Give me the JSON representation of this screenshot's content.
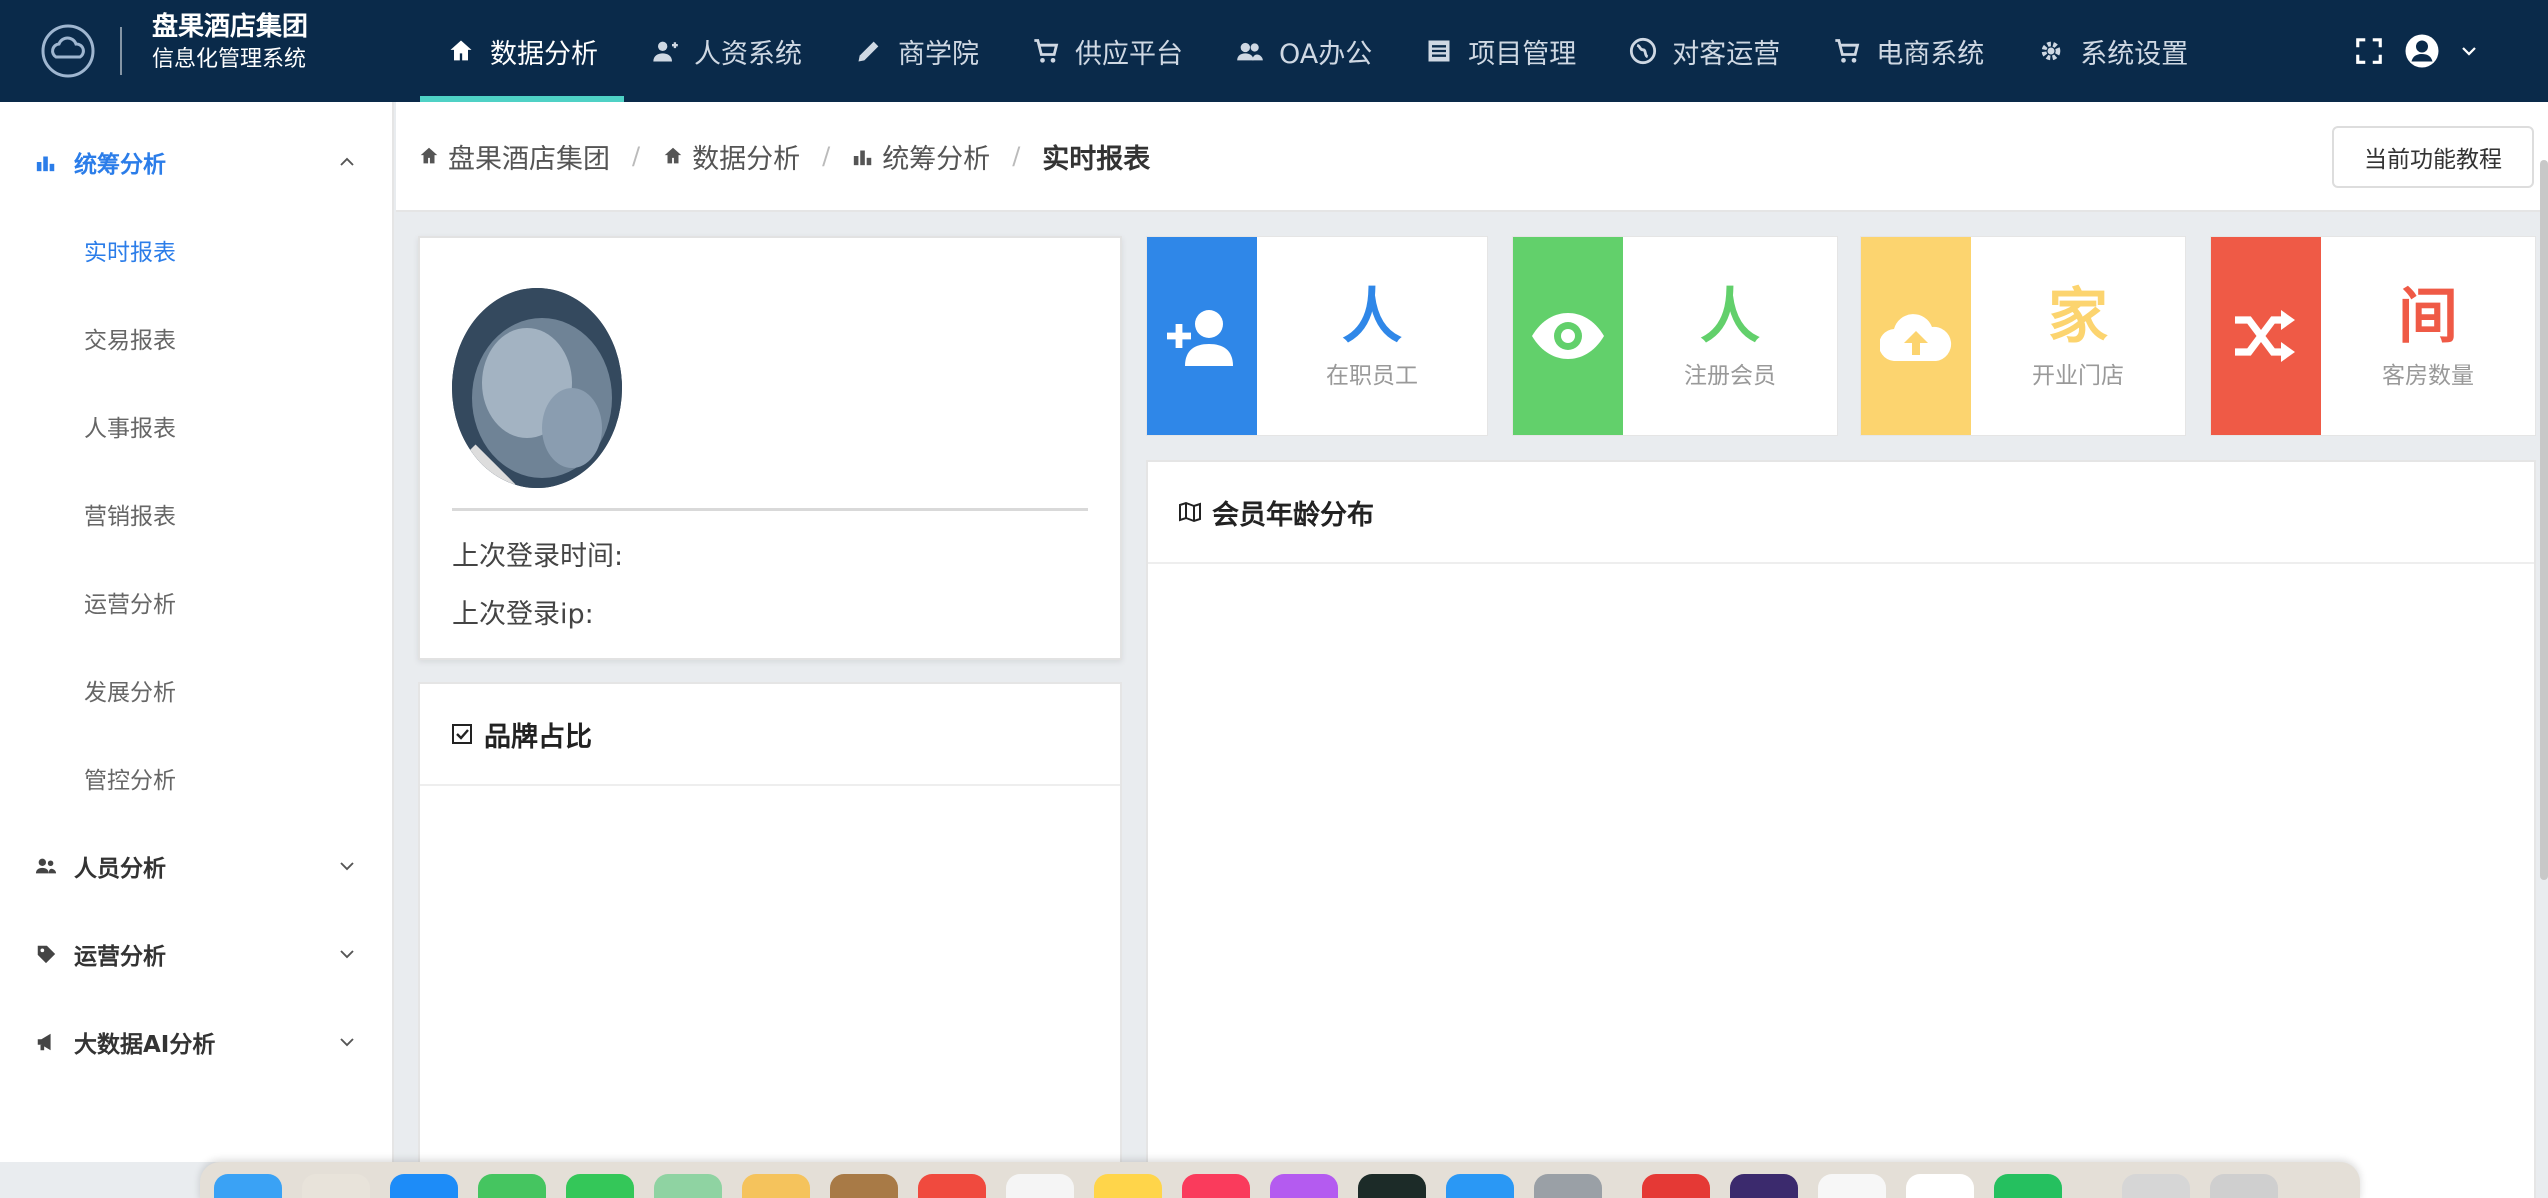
{
  "header": {
    "company": "盘果酒店集团",
    "system": "信息化管理系统",
    "nav": [
      {
        "label": "数据分析",
        "icon": "home-icon",
        "active": true
      },
      {
        "label": "人资系统",
        "icon": "user-add-icon"
      },
      {
        "label": "商学院",
        "icon": "pencil-icon"
      },
      {
        "label": "供应平台",
        "icon": "cart-icon"
      },
      {
        "label": "OA办公",
        "icon": "users-icon"
      },
      {
        "label": "项目管理",
        "icon": "list-icon"
      },
      {
        "label": "对客运营",
        "icon": "globe-icon"
      },
      {
        "label": "电商系统",
        "icon": "cart-icon"
      },
      {
        "label": "系统设置",
        "icon": "gear-icon"
      }
    ]
  },
  "sidebar": {
    "groups": [
      {
        "label": "统筹分析",
        "icon": "bar-chart-icon",
        "open": true,
        "items": [
          "实时报表",
          "交易报表",
          "人事报表",
          "营销报表",
          "运营分析",
          "发展分析",
          "管控分析"
        ],
        "active_item": "实时报表"
      },
      {
        "label": "人员分析",
        "icon": "people-icon",
        "open": false
      },
      {
        "label": "运营分析",
        "icon": "tag-icon",
        "open": false
      },
      {
        "label": "大数据AI分析",
        "icon": "megaphone-icon",
        "open": false
      }
    ]
  },
  "breadcrumb": {
    "items": [
      "盘果酒店集团",
      "数据分析",
      "统筹分析"
    ],
    "current": "实时报表",
    "tutorial_button": "当前功能教程"
  },
  "profile": {
    "last_login_time": "上次登录时间:",
    "last_login_ip": "上次登录ip:"
  },
  "stats": [
    {
      "unit": "人",
      "label": "在职员工",
      "color": "#2f87e8",
      "icon": "user-plus-icon"
    },
    {
      "unit": "人",
      "label": "注册会员",
      "color": "#62d06b",
      "icon": "eye-icon"
    },
    {
      "unit": "家",
      "label": "开业门店",
      "color": "#fcd46f",
      "icon": "cloud-upload-icon"
    },
    {
      "unit": "间",
      "label": "客房数量",
      "color": "#ef5a46",
      "icon": "shuffle-icon"
    }
  ],
  "cards": {
    "brand_share": "品牌占比",
    "member_age": "会员年龄分布"
  }
}
